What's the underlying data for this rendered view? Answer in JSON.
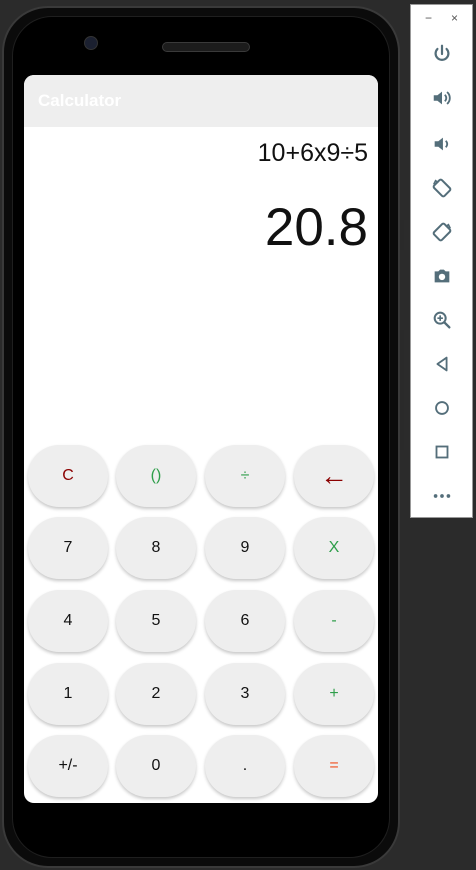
{
  "app": {
    "title": "Calculator"
  },
  "display": {
    "expression": "10+6x9÷5",
    "result": "20.8"
  },
  "keys": [
    [
      "C",
      "()",
      "÷",
      "←"
    ],
    [
      "7",
      "8",
      "9",
      "X"
    ],
    [
      "4",
      "5",
      "6",
      "-"
    ],
    [
      "1",
      "2",
      "3",
      "+"
    ],
    [
      "+/-",
      "0",
      ".",
      "="
    ]
  ],
  "colors": {
    "clear": "#8b0000",
    "operator": "#2e9e4a",
    "equals": "#f04e1f",
    "key_bg": "#eeeeee",
    "appbar_bg": "#eeeeee",
    "toolbar_icon": "#546e7a"
  },
  "emulator_toolbar": {
    "minimize": "−",
    "close": "×",
    "icons": [
      "power-icon",
      "volume-up-icon",
      "volume-down-icon",
      "rotate-left-icon",
      "rotate-right-icon",
      "camera-icon",
      "zoom-icon",
      "back-icon",
      "home-icon",
      "overview-icon",
      "more-icon"
    ]
  }
}
